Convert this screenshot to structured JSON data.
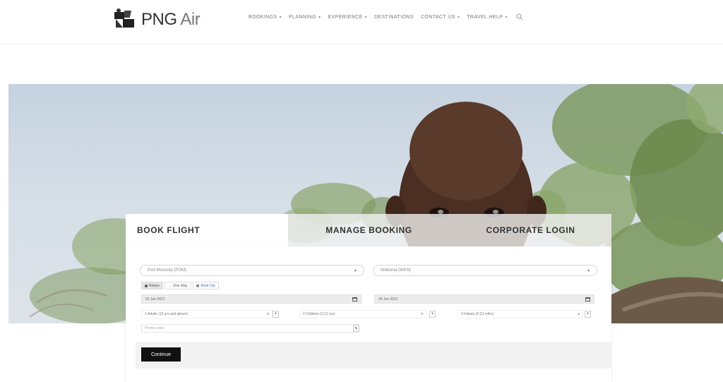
{
  "brand": {
    "name_main": "PNG",
    "name_air": "Air"
  },
  "nav": {
    "items": [
      {
        "label": "Bookings",
        "caret": true
      },
      {
        "label": "Planning",
        "caret": true
      },
      {
        "label": "Experience",
        "caret": true
      },
      {
        "label": "Destinations",
        "caret": false
      },
      {
        "label": "Contact Us",
        "caret": true
      },
      {
        "label": "Travel Help",
        "caret": true
      }
    ]
  },
  "booking": {
    "tabs": {
      "book": "Book Flight",
      "manage": "Manage Booking",
      "corporate": "Corporate Login"
    },
    "origin": "Port Moresby (POM)",
    "destination": "Wakunai (WKN)",
    "trip_types": {
      "return": "Return",
      "one_way": "One Way",
      "multi_city": "Multi City"
    },
    "depart_date": "02 Jun 2021",
    "return_date": "09 Jun 2021",
    "adults": "1 Adults (12 yrs and above)",
    "children": "0 Children (2-11 yrs)",
    "infants": "0 Infants (0-23 mths)",
    "promo_placeholder": "Promo code",
    "continue_label": "Continue"
  },
  "colors": {
    "accent": "#111111",
    "link": "#4a78b8",
    "tab_inactive": "#f0f0f0"
  }
}
